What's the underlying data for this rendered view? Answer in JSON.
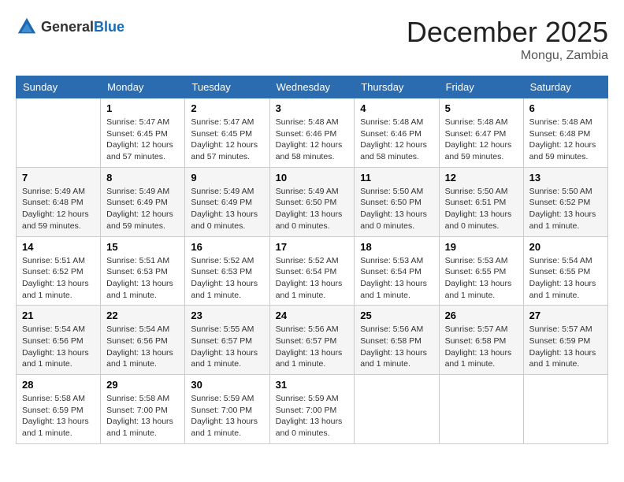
{
  "logo": {
    "general": "General",
    "blue": "Blue"
  },
  "title": "December 2025",
  "subtitle": "Mongu, Zambia",
  "days_header": [
    "Sunday",
    "Monday",
    "Tuesday",
    "Wednesday",
    "Thursday",
    "Friday",
    "Saturday"
  ],
  "weeks": [
    [
      {
        "day": "",
        "info": ""
      },
      {
        "day": "1",
        "info": "Sunrise: 5:47 AM\nSunset: 6:45 PM\nDaylight: 12 hours\nand 57 minutes."
      },
      {
        "day": "2",
        "info": "Sunrise: 5:47 AM\nSunset: 6:45 PM\nDaylight: 12 hours\nand 57 minutes."
      },
      {
        "day": "3",
        "info": "Sunrise: 5:48 AM\nSunset: 6:46 PM\nDaylight: 12 hours\nand 58 minutes."
      },
      {
        "day": "4",
        "info": "Sunrise: 5:48 AM\nSunset: 6:46 PM\nDaylight: 12 hours\nand 58 minutes."
      },
      {
        "day": "5",
        "info": "Sunrise: 5:48 AM\nSunset: 6:47 PM\nDaylight: 12 hours\nand 59 minutes."
      },
      {
        "day": "6",
        "info": "Sunrise: 5:48 AM\nSunset: 6:48 PM\nDaylight: 12 hours\nand 59 minutes."
      }
    ],
    [
      {
        "day": "7",
        "info": "Sunrise: 5:49 AM\nSunset: 6:48 PM\nDaylight: 12 hours\nand 59 minutes."
      },
      {
        "day": "8",
        "info": "Sunrise: 5:49 AM\nSunset: 6:49 PM\nDaylight: 12 hours\nand 59 minutes."
      },
      {
        "day": "9",
        "info": "Sunrise: 5:49 AM\nSunset: 6:49 PM\nDaylight: 13 hours\nand 0 minutes."
      },
      {
        "day": "10",
        "info": "Sunrise: 5:49 AM\nSunset: 6:50 PM\nDaylight: 13 hours\nand 0 minutes."
      },
      {
        "day": "11",
        "info": "Sunrise: 5:50 AM\nSunset: 6:50 PM\nDaylight: 13 hours\nand 0 minutes."
      },
      {
        "day": "12",
        "info": "Sunrise: 5:50 AM\nSunset: 6:51 PM\nDaylight: 13 hours\nand 0 minutes."
      },
      {
        "day": "13",
        "info": "Sunrise: 5:50 AM\nSunset: 6:52 PM\nDaylight: 13 hours\nand 1 minute."
      }
    ],
    [
      {
        "day": "14",
        "info": "Sunrise: 5:51 AM\nSunset: 6:52 PM\nDaylight: 13 hours\nand 1 minute."
      },
      {
        "day": "15",
        "info": "Sunrise: 5:51 AM\nSunset: 6:53 PM\nDaylight: 13 hours\nand 1 minute."
      },
      {
        "day": "16",
        "info": "Sunrise: 5:52 AM\nSunset: 6:53 PM\nDaylight: 13 hours\nand 1 minute."
      },
      {
        "day": "17",
        "info": "Sunrise: 5:52 AM\nSunset: 6:54 PM\nDaylight: 13 hours\nand 1 minute."
      },
      {
        "day": "18",
        "info": "Sunrise: 5:53 AM\nSunset: 6:54 PM\nDaylight: 13 hours\nand 1 minute."
      },
      {
        "day": "19",
        "info": "Sunrise: 5:53 AM\nSunset: 6:55 PM\nDaylight: 13 hours\nand 1 minute."
      },
      {
        "day": "20",
        "info": "Sunrise: 5:54 AM\nSunset: 6:55 PM\nDaylight: 13 hours\nand 1 minute."
      }
    ],
    [
      {
        "day": "21",
        "info": "Sunrise: 5:54 AM\nSunset: 6:56 PM\nDaylight: 13 hours\nand 1 minute."
      },
      {
        "day": "22",
        "info": "Sunrise: 5:54 AM\nSunset: 6:56 PM\nDaylight: 13 hours\nand 1 minute."
      },
      {
        "day": "23",
        "info": "Sunrise: 5:55 AM\nSunset: 6:57 PM\nDaylight: 13 hours\nand 1 minute."
      },
      {
        "day": "24",
        "info": "Sunrise: 5:56 AM\nSunset: 6:57 PM\nDaylight: 13 hours\nand 1 minute."
      },
      {
        "day": "25",
        "info": "Sunrise: 5:56 AM\nSunset: 6:58 PM\nDaylight: 13 hours\nand 1 minute."
      },
      {
        "day": "26",
        "info": "Sunrise: 5:57 AM\nSunset: 6:58 PM\nDaylight: 13 hours\nand 1 minute."
      },
      {
        "day": "27",
        "info": "Sunrise: 5:57 AM\nSunset: 6:59 PM\nDaylight: 13 hours\nand 1 minute."
      }
    ],
    [
      {
        "day": "28",
        "info": "Sunrise: 5:58 AM\nSunset: 6:59 PM\nDaylight: 13 hours\nand 1 minute."
      },
      {
        "day": "29",
        "info": "Sunrise: 5:58 AM\nSunset: 7:00 PM\nDaylight: 13 hours\nand 1 minute."
      },
      {
        "day": "30",
        "info": "Sunrise: 5:59 AM\nSunset: 7:00 PM\nDaylight: 13 hours\nand 1 minute."
      },
      {
        "day": "31",
        "info": "Sunrise: 5:59 AM\nSunset: 7:00 PM\nDaylight: 13 hours\nand 0 minutes."
      },
      {
        "day": "",
        "info": ""
      },
      {
        "day": "",
        "info": ""
      },
      {
        "day": "",
        "info": ""
      }
    ]
  ]
}
